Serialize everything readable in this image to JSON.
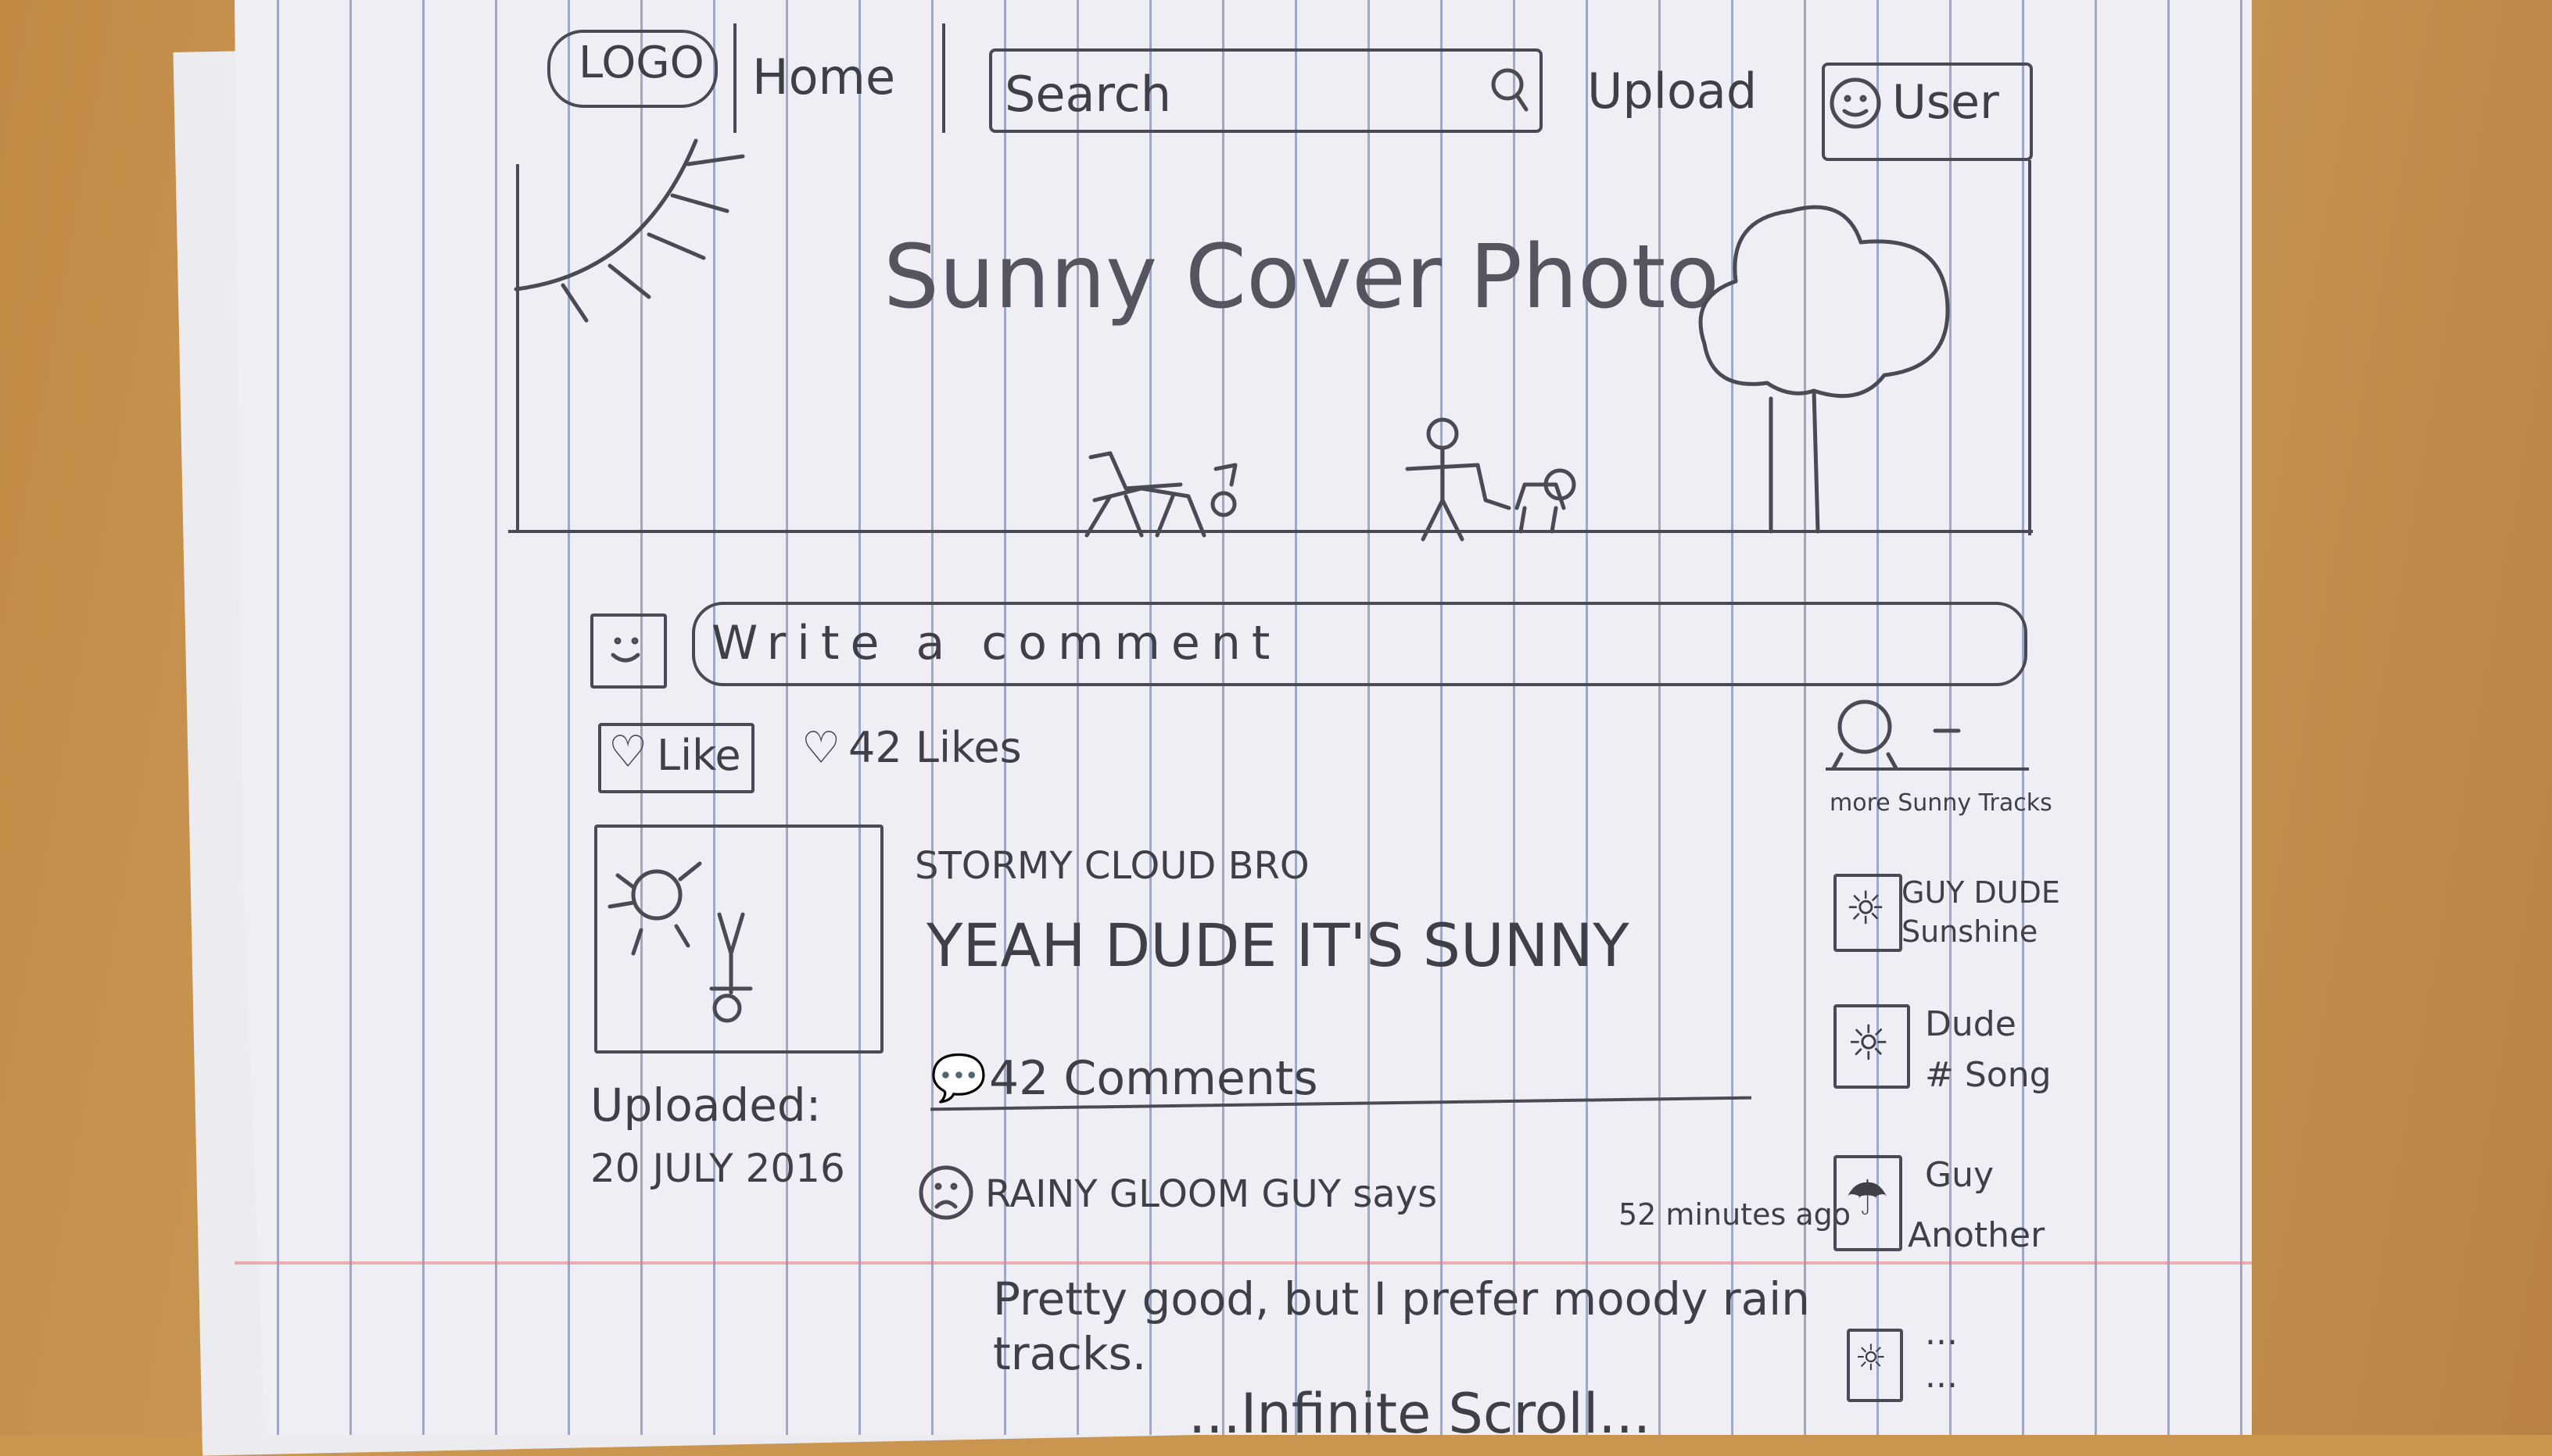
{
  "nav": {
    "logo": "LOGO",
    "home": "Home",
    "search_placeholder": "Search",
    "upload": "Upload",
    "user": "User"
  },
  "cover": {
    "title": "Sunny Cover Photo"
  },
  "comment_box": {
    "placeholder": "Write a comment"
  },
  "likes": {
    "like_label": "Like",
    "count_label": "42 Likes"
  },
  "track": {
    "artist": "STORMY CLOUD BRO",
    "title": "YEAH DUDE IT'S SUNNY",
    "uploaded_label": "Uploaded:",
    "uploaded_date": "20 JULY 2016",
    "comments_label": "42 Comments"
  },
  "comment": {
    "author": "RAINY GLOOM GUY says",
    "time": "52 minutes ago",
    "text_line1": "Pretty good, but I prefer moody rain",
    "text_line2": "tracks."
  },
  "sidebar": {
    "heading": "more Sunny Tracks",
    "items": [
      {
        "line1": "GUY DUDE",
        "line2": "Sunshine"
      },
      {
        "line1": "Dude",
        "line2": "# Song"
      },
      {
        "line1": "Guy",
        "line2": "Another"
      },
      {
        "line1": "...",
        "line2": "..."
      }
    ]
  },
  "footer": {
    "infinite_scroll": "...Infinite Scroll..."
  }
}
